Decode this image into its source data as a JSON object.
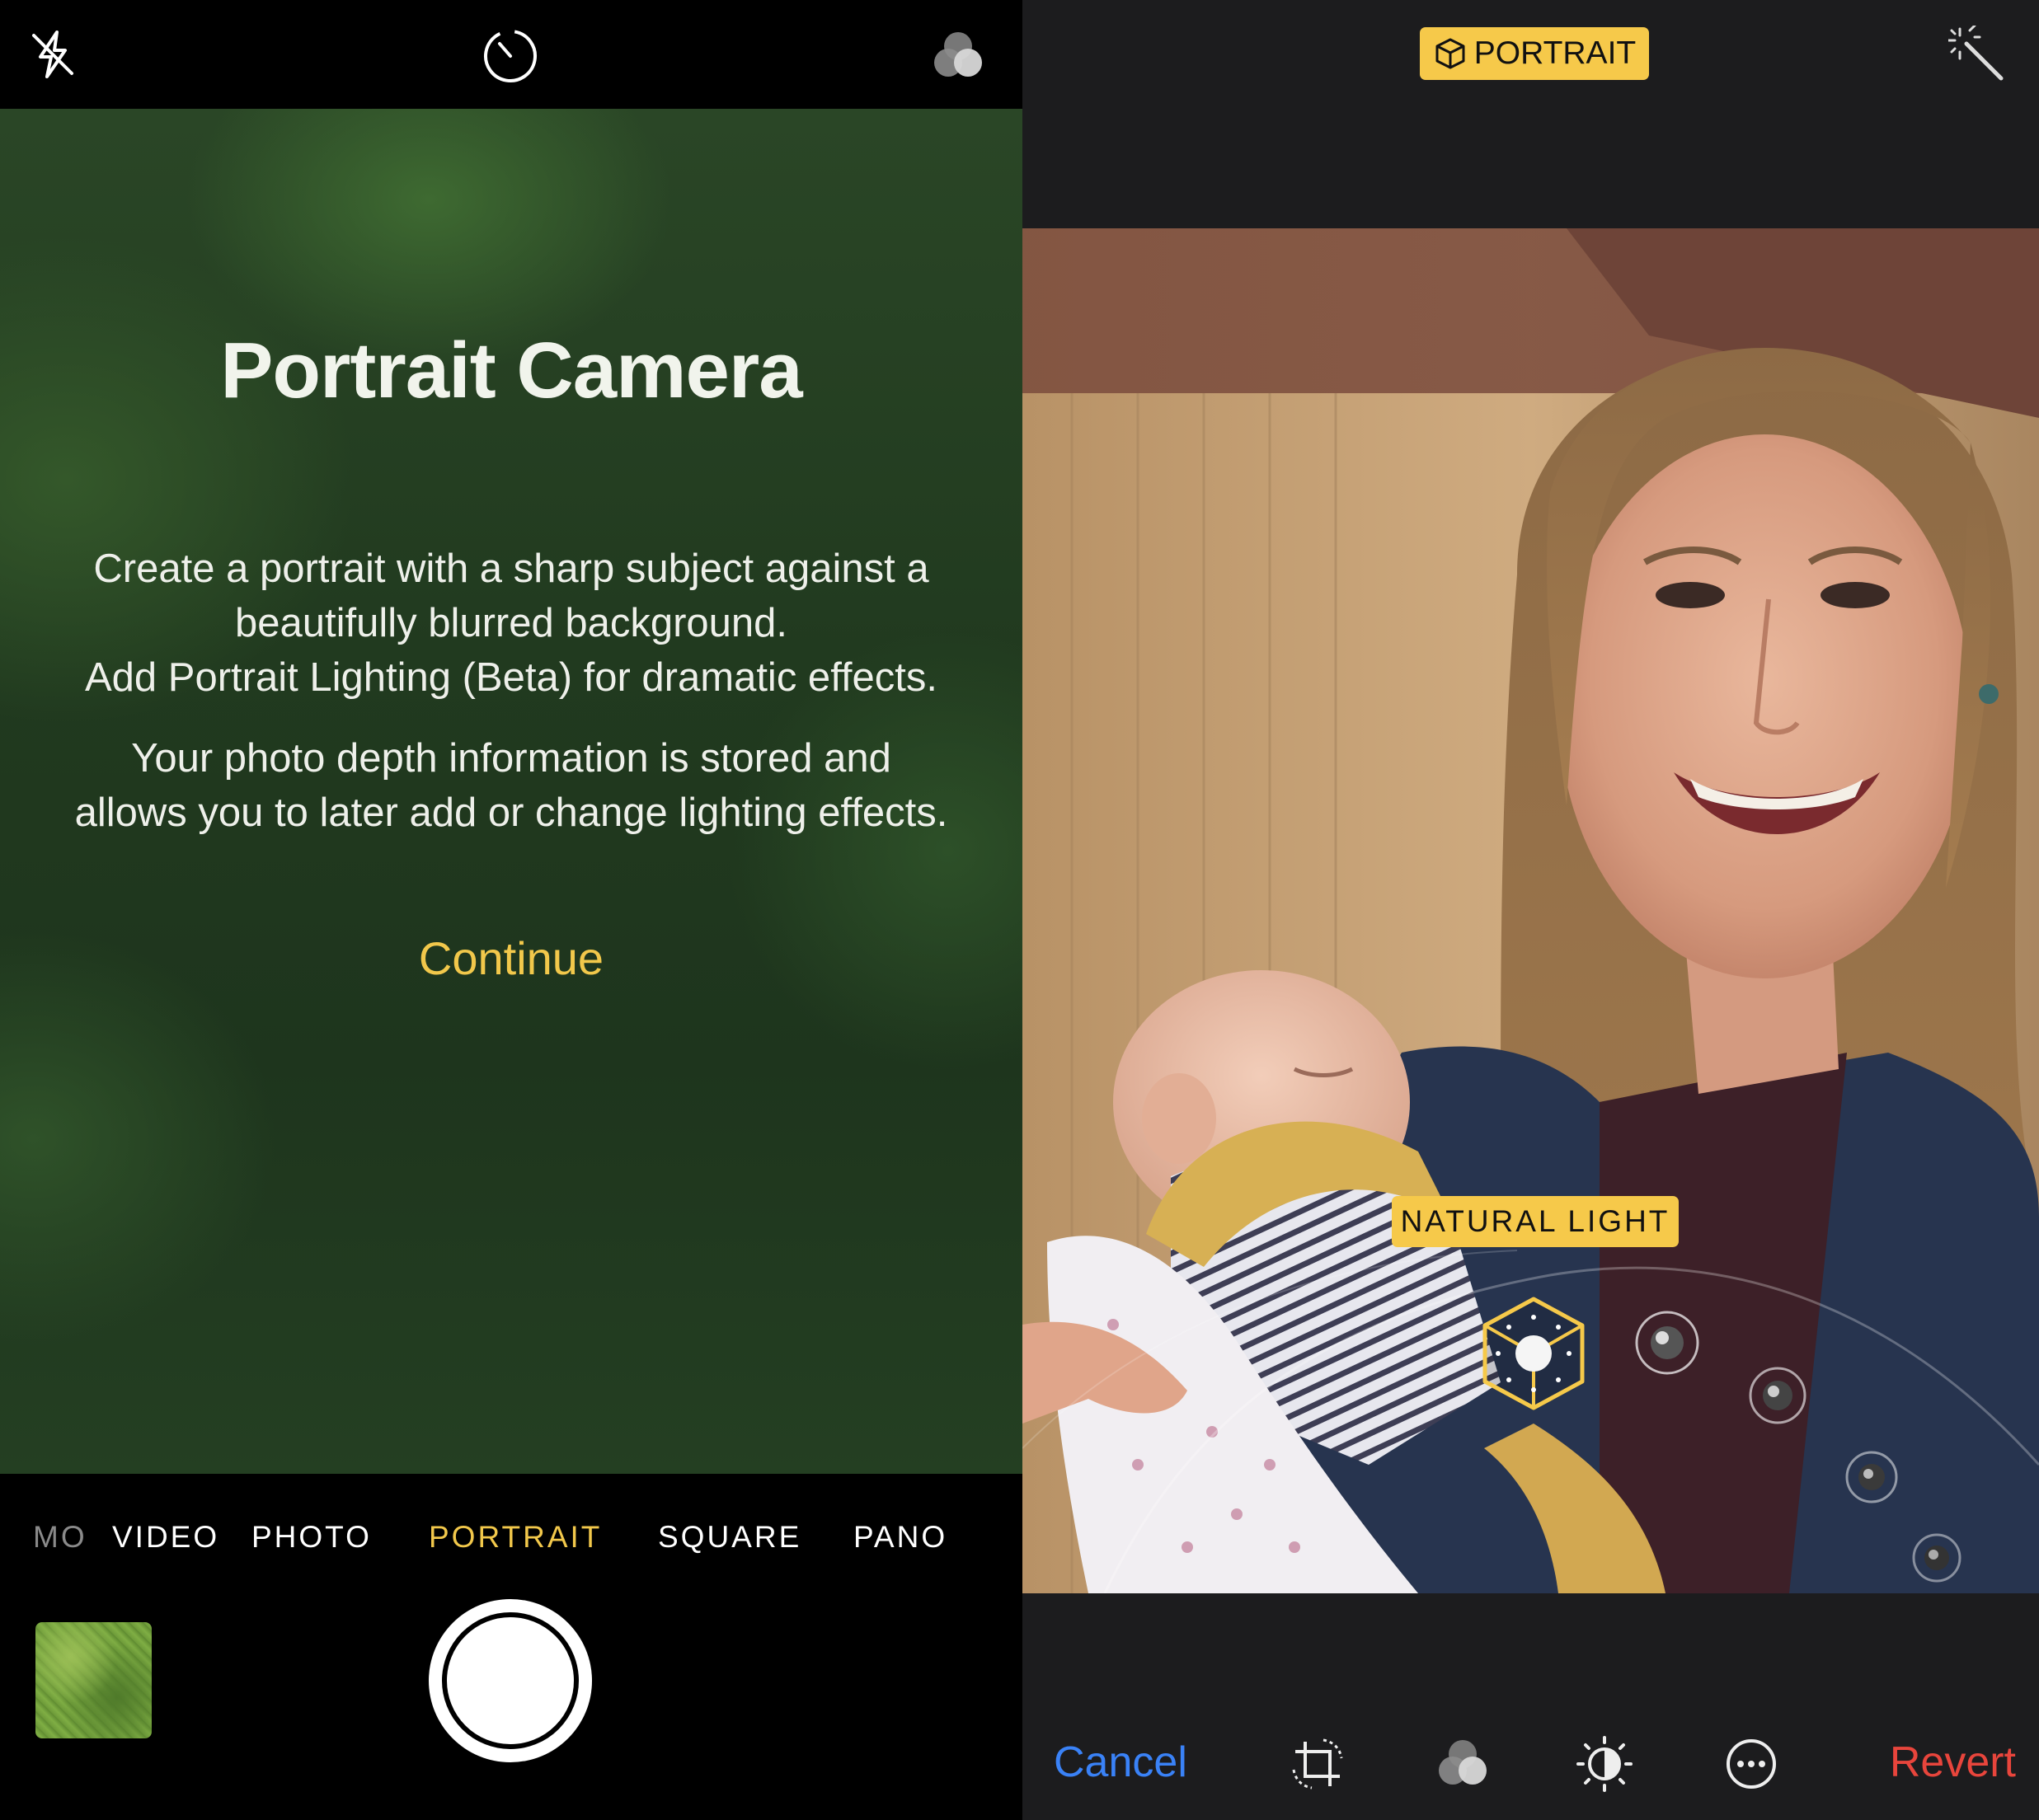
{
  "camera": {
    "intro": {
      "title": "Portrait Camera",
      "paragraph1_line1": "Create a portrait with a sharp subject against a",
      "paragraph1_line2": "beautifully blurred background.",
      "paragraph1_line3": "Add Portrait Lighting (Beta) for dramatic effects.",
      "paragraph2_line1": "Your photo depth information is stored and",
      "paragraph2_line2": "allows you to later add or change lighting effects.",
      "continue_label": "Continue"
    },
    "top_icons": [
      "flash-off-icon",
      "timer-icon",
      "filters-icon"
    ],
    "modes": [
      {
        "label": "MO",
        "selected": false
      },
      {
        "label": "VIDEO",
        "selected": false
      },
      {
        "label": "PHOTO",
        "selected": false
      },
      {
        "label": "PORTRAIT",
        "selected": true
      },
      {
        "label": "SQUARE",
        "selected": false
      },
      {
        "label": "PANO",
        "selected": false
      }
    ]
  },
  "editor": {
    "badge_label": "PORTRAIT",
    "lighting_label": "NATURAL LIGHT",
    "cancel_label": "Cancel",
    "revert_label": "Revert",
    "toolbar_icons": [
      "crop-rotate-icon",
      "filters-icon",
      "adjust-icon",
      "more-icon"
    ]
  },
  "colors": {
    "accent_yellow": "#f2c84b",
    "badge_yellow": "#f6c94a",
    "cancel_blue": "#3a82f7",
    "revert_red": "#e8453c",
    "editor_background": "#1c1c1e"
  }
}
